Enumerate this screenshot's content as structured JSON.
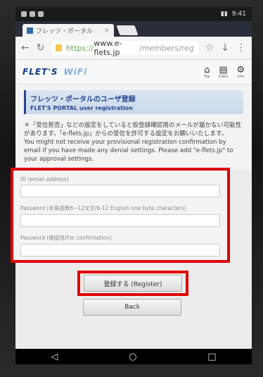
{
  "status": {
    "time": "9:41"
  },
  "browser": {
    "tab_title": "フレッツ・ポータル",
    "url_scheme": "https://",
    "url_host": "www.e-flets.jp",
    "url_path": "/members/reg"
  },
  "site": {
    "logo_text": "FLET'S",
    "logo_wifi": "WiFi",
    "icons": [
      {
        "label": "Top"
      },
      {
        "label": "Index"
      },
      {
        "label": "Info"
      }
    ]
  },
  "page": {
    "title_jp": "フレッツ・ポータルのユーザ登録",
    "title_en": "FLET'S PORTAL user registration",
    "notice_jp": "＊「受信拒否」などの設定をしていると仮登録確認用のメールが届かない可能性があります。「e-flets.jp」からの受信を許可する設定をお願いいたします。",
    "notice_en": "You might not receive your provisional registration confirmation by email if you have made any denial settings. Please add \"e-flets.jp\" to your approval settings."
  },
  "form": {
    "id_label": "ID (email address)",
    "password_label": "Password (半角英数6~12文字/6-12 English one byte characters)",
    "confirm_label": "Password (確認用/For confirmation)"
  },
  "buttons": {
    "register": "登録する (Register)",
    "back": "Back"
  }
}
